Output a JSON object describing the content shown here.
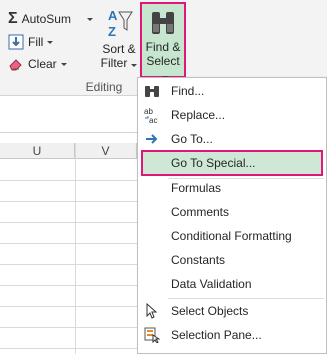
{
  "ribbon": {
    "autosum_label": "AutoSum",
    "fill_label": "Fill",
    "clear_label": "Clear",
    "sort_label_1": "Sort &",
    "sort_label_2": "Filter",
    "find_label_1": "Find &",
    "find_label_2": "Select",
    "group_label": "Editing"
  },
  "sheet": {
    "columns": [
      "U",
      "V"
    ]
  },
  "menu": {
    "items": [
      {
        "label": "Find...",
        "icon": "binoculars-icon"
      },
      {
        "label": "Replace...",
        "icon": "replace-icon"
      },
      {
        "label": "Go To...",
        "icon": "arrow-right-icon"
      },
      {
        "label": "Go To Special...",
        "icon": ""
      },
      {
        "label": "Formulas",
        "icon": ""
      },
      {
        "label": "Comments",
        "icon": ""
      },
      {
        "label": "Conditional Formatting",
        "icon": ""
      },
      {
        "label": "Constants",
        "icon": ""
      },
      {
        "label": "Data Validation",
        "icon": ""
      },
      {
        "label": "Select Objects",
        "icon": "cursor-icon"
      },
      {
        "label": "Selection Pane...",
        "icon": "selection-pane-icon"
      }
    ]
  },
  "colors": {
    "highlight_border": "#e0177a",
    "highlight_fill": "#cfe8d6"
  }
}
